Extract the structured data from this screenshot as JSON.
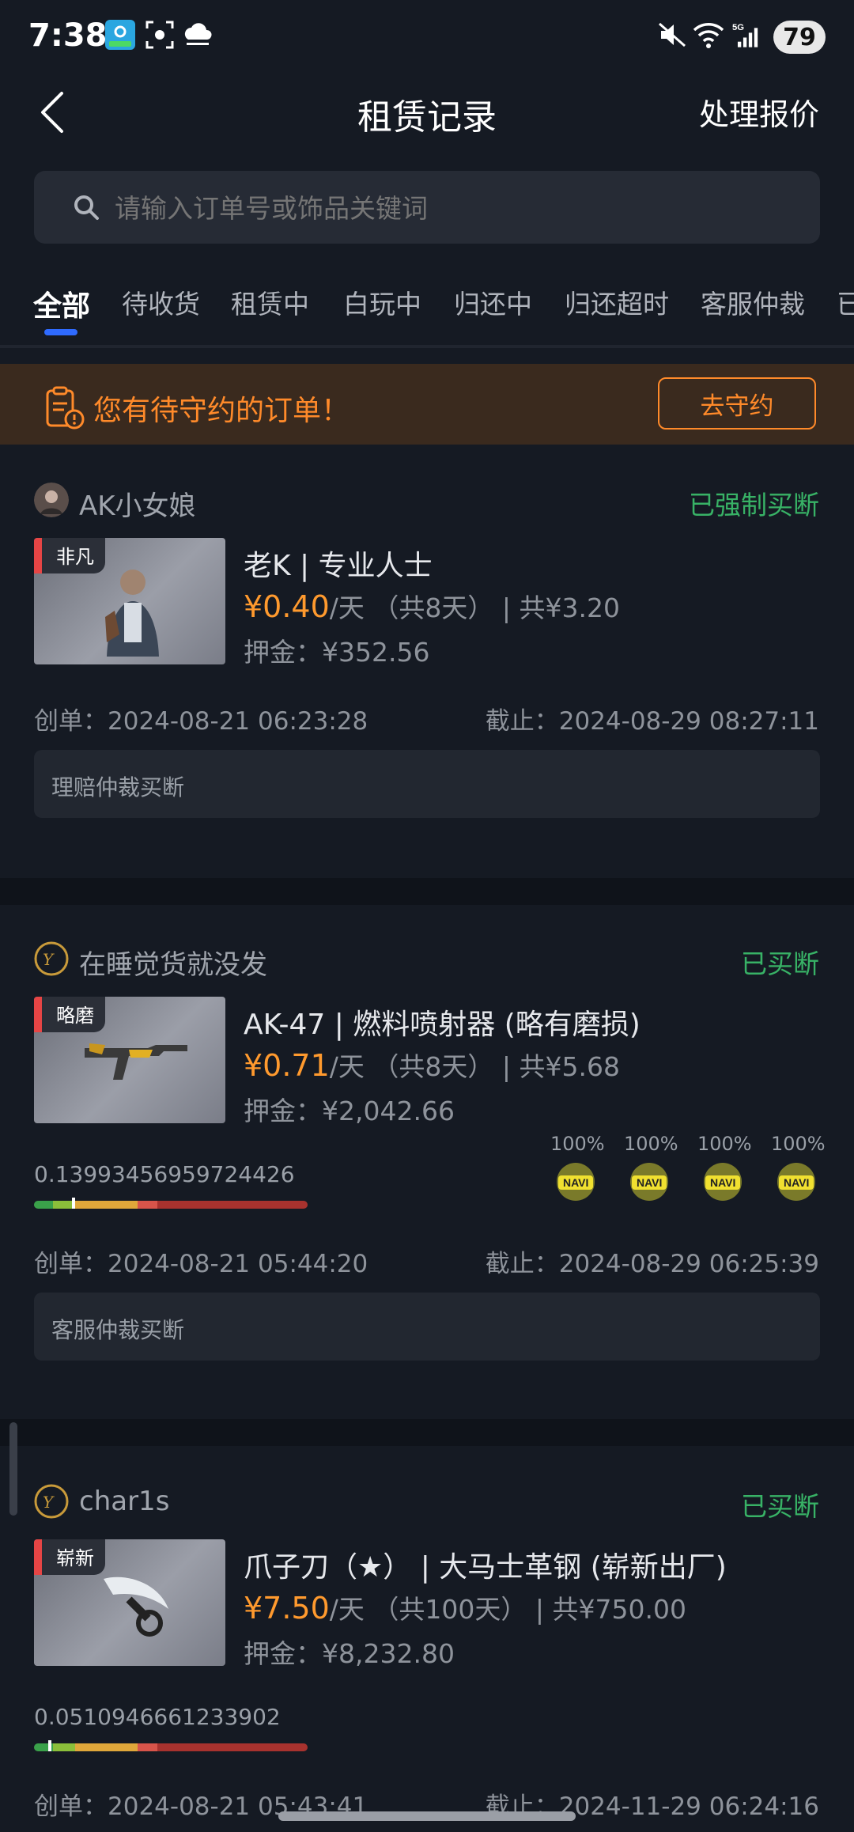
{
  "status_bar": {
    "time": "7:38",
    "battery": "79"
  },
  "header": {
    "title": "租赁记录",
    "action": "处理报价"
  },
  "search": {
    "placeholder": "请输入订单号或饰品关键词"
  },
  "tabs": [
    "全部",
    "待收货",
    "租赁中",
    "白玩中",
    "归还中",
    "归还超时",
    "客服仲裁",
    "已"
  ],
  "banner": {
    "text": "您有待守约的订单！",
    "button": "去守约"
  },
  "orders": [
    {
      "user": "AK小女娘",
      "status": "已强制买断",
      "rarity": "非凡",
      "name": "老K | 专业人士",
      "price": "¥0.40",
      "per_day": "/天",
      "rent_info": "（共8天） | 共¥3.20",
      "deposit": "押金：¥352.56",
      "created": "创单：2024-08-21 06:23:28",
      "deadline": "截止：2024-08-29 08:27:11",
      "note": "理赔仲裁买断"
    },
    {
      "user": "在睡觉货就没发",
      "status": "已买断",
      "rarity": "略磨",
      "name": "AK-47 | 燃料喷射器 (略有磨损)",
      "price": "¥0.71",
      "per_day": "/天",
      "rent_info": "（共8天） | 共¥5.68",
      "deposit": "押金：¥2,042.66",
      "float": "0.13993456959724426",
      "float_value": 0.13993456959724426,
      "stickers": [
        "100%",
        "100%",
        "100%",
        "100%"
      ],
      "created": "创单：2024-08-21 05:44:20",
      "deadline": "截止：2024-08-29 06:25:39",
      "note": "客服仲裁买断"
    },
    {
      "user": "char1s",
      "status": "已买断",
      "rarity": "崭新",
      "name": "爪子刀（★） | 大马士革钢 (崭新出厂)",
      "price": "¥7.50",
      "per_day": "/天",
      "rent_info": "（共100天） | 共¥750.00",
      "deposit": "押金：¥8,232.80",
      "float": "0.0510946661233902",
      "float_value": 0.0510946661233902,
      "created": "创单：2024-08-21 05:43:41",
      "deadline": "截止：2024-11-29 06:24:16"
    }
  ],
  "colors": {
    "accent": "#2f6bff",
    "orange": "#ff8a2a",
    "price": "#ff9a2e",
    "green": "#38b266",
    "rarity_red": "#e64545"
  }
}
